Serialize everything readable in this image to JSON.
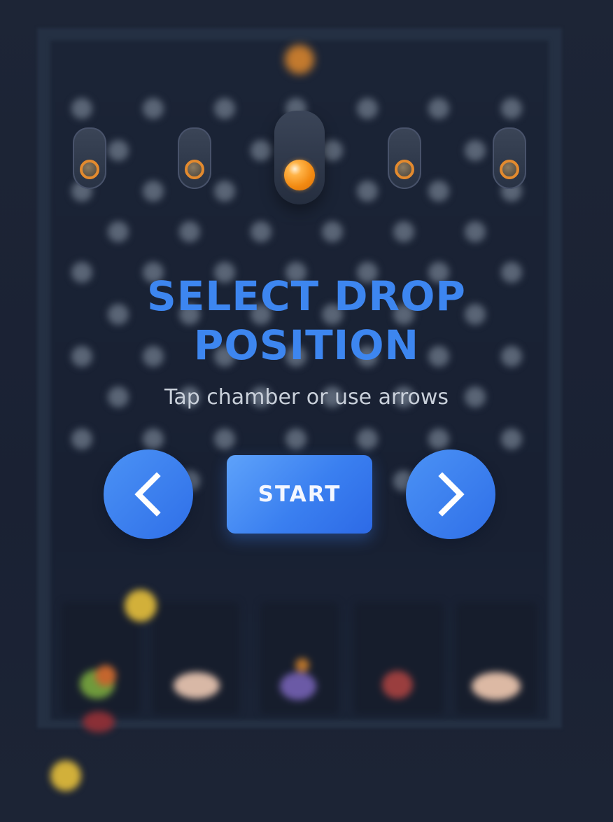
{
  "overlay": {
    "title_line1": "SELECT DROP",
    "title_line2": "POSITION",
    "subtitle": "Tap chamber or use arrows",
    "start_label": "START"
  },
  "chambers": [
    {
      "id": 1,
      "selected": false
    },
    {
      "id": 2,
      "selected": false
    },
    {
      "id": 3,
      "selected": true
    },
    {
      "id": 4,
      "selected": false
    },
    {
      "id": 5,
      "selected": false
    }
  ],
  "controls": {
    "left_icon": "chevron-left-icon",
    "right_icon": "chevron-right-icon"
  },
  "colors": {
    "accent": "#3d86f0",
    "button": "#3a7ff0",
    "ball": "#f28a12",
    "background": "#1b2334"
  }
}
